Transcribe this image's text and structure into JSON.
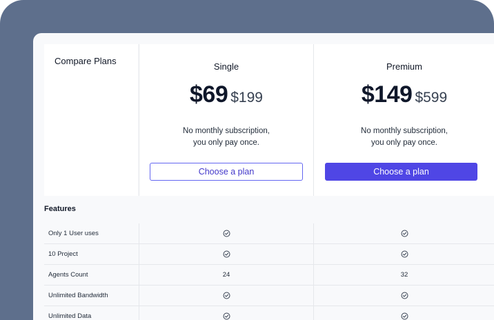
{
  "compare_title": "Compare Plans",
  "plans": [
    {
      "name": "Single",
      "price": "$69",
      "old_price": "$199",
      "note_line1": "No monthly subscription,",
      "note_line2": "you only pay once.",
      "button_label": "Choose a plan",
      "button_style": "outline"
    },
    {
      "name": "Premium",
      "price": "$149",
      "old_price": "$599",
      "note_line1": "No monthly subscription,",
      "note_line2": "you only pay once.",
      "button_label": "Choose a plan",
      "button_style": "solid"
    }
  ],
  "features_title": "Features",
  "features": [
    {
      "label": "Only 1 User uses",
      "single": "check-icon",
      "premium": "check-icon"
    },
    {
      "label": "10 Project",
      "single": "check-icon",
      "premium": "check-icon"
    },
    {
      "label": "Agents Count",
      "single": "24",
      "premium": "32"
    },
    {
      "label": "Unlimited Bandwidth",
      "single": "check-icon",
      "premium": "check-icon"
    },
    {
      "label": "Unlimited Data",
      "single": "check-icon",
      "premium": "check-icon"
    }
  ],
  "colors": {
    "frame_bg": "#5e6f8c",
    "accent": "#4f46e5",
    "panel_bg": "#f8f9fb"
  }
}
